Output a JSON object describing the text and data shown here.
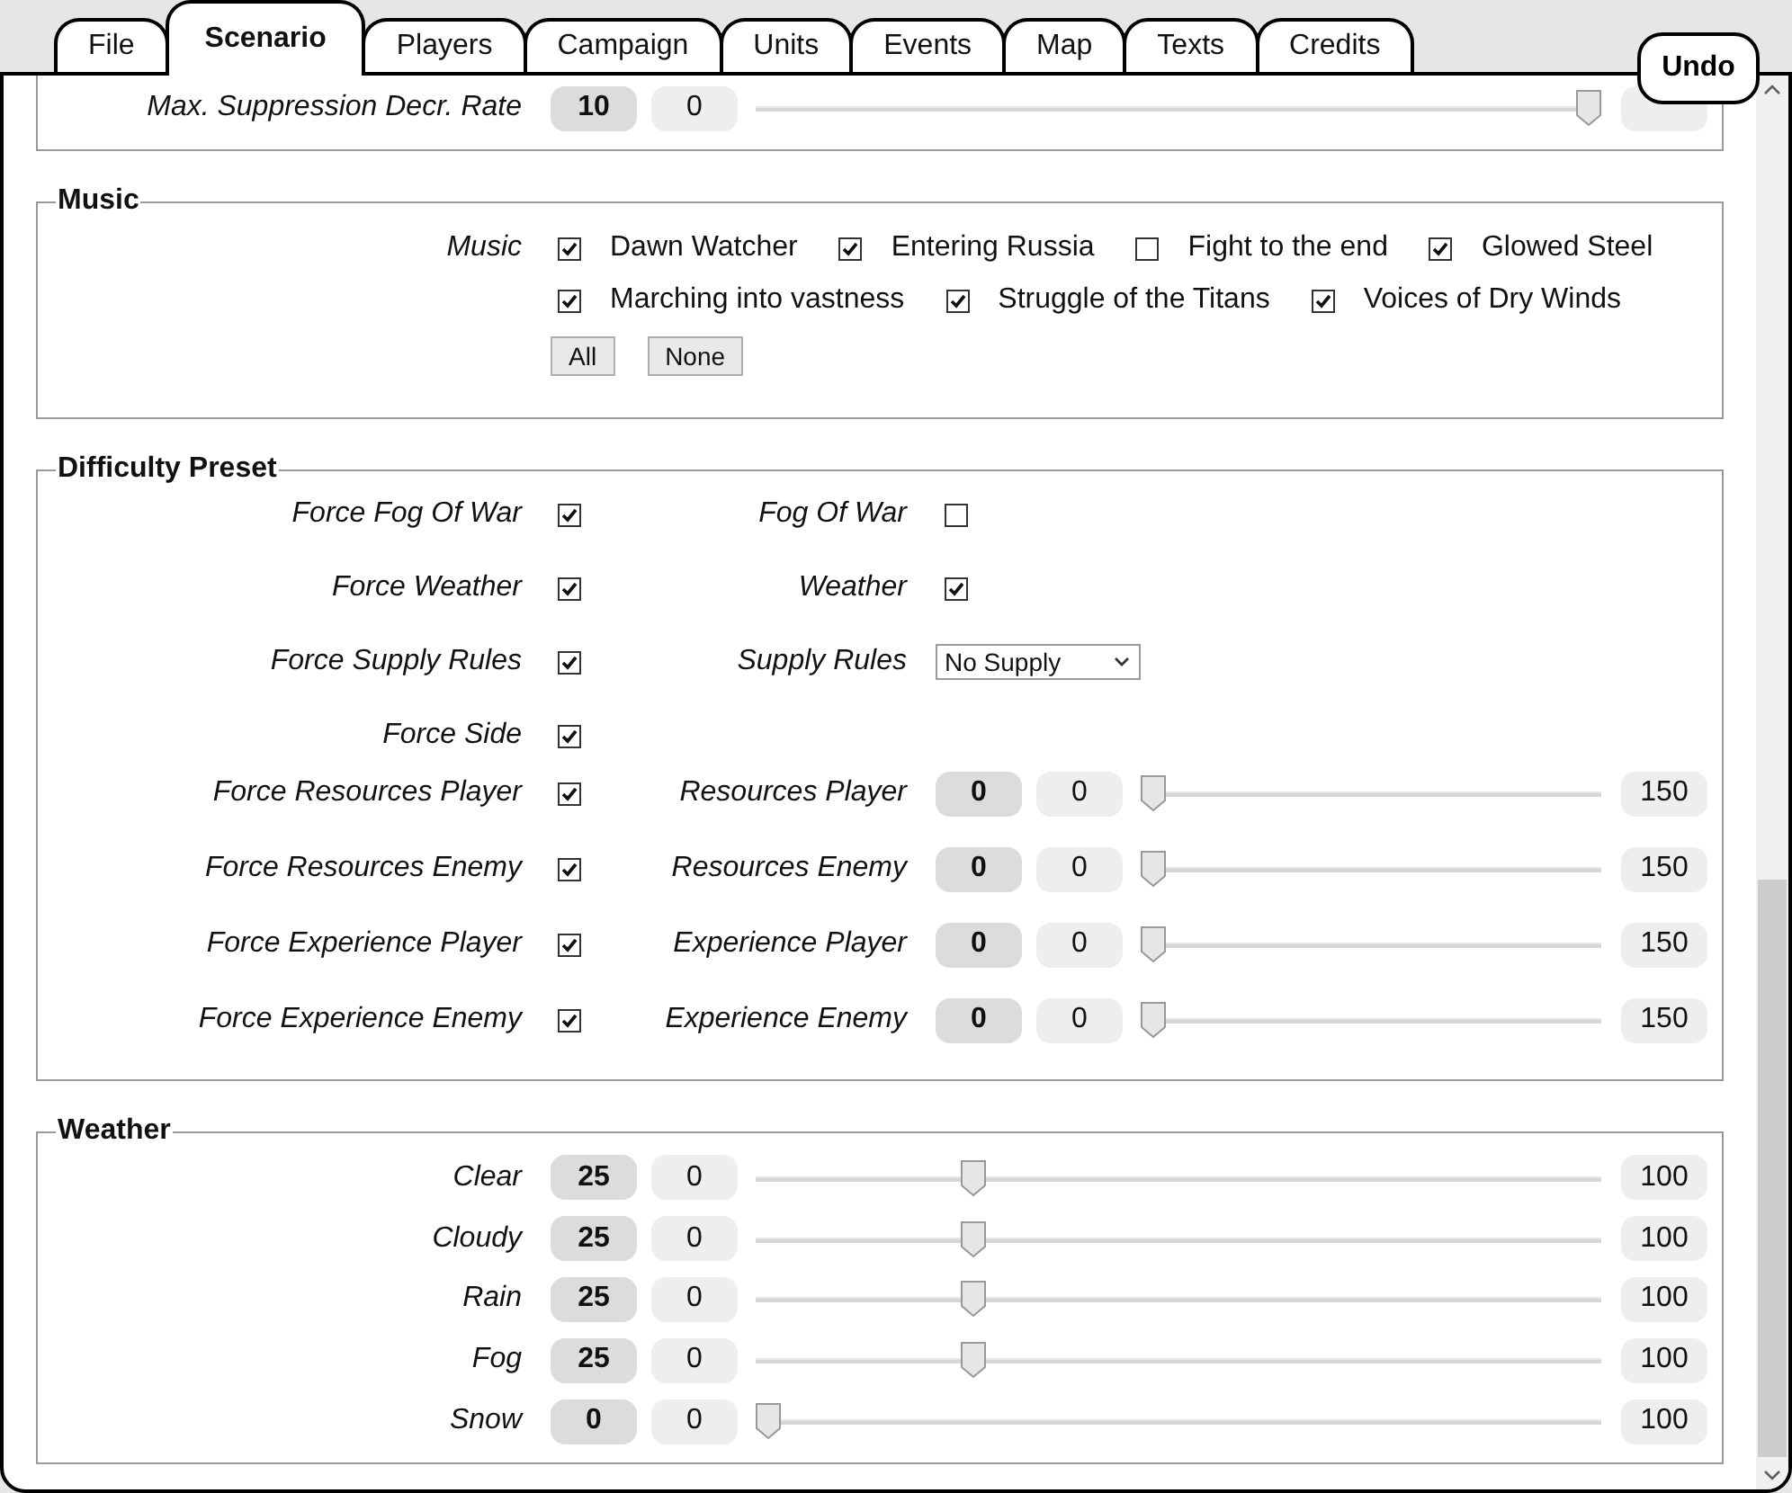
{
  "tabs": [
    {
      "label": "File",
      "selected": false
    },
    {
      "label": "Scenario",
      "selected": true
    },
    {
      "label": "Players",
      "selected": false
    },
    {
      "label": "Campaign",
      "selected": false
    },
    {
      "label": "Units",
      "selected": false
    },
    {
      "label": "Events",
      "selected": false
    },
    {
      "label": "Map",
      "selected": false
    },
    {
      "label": "Texts",
      "selected": false
    },
    {
      "label": "Credits",
      "selected": false
    }
  ],
  "undo_button": "Undo",
  "top_section": {
    "rows": [
      {
        "label": "Max. Suppression Decr. Rate",
        "value": "10",
        "min": "0",
        "level": 1
      }
    ]
  },
  "music": {
    "title": "Music",
    "label": "Music",
    "tracks": [
      {
        "name": "Dawn Watcher",
        "checked": true
      },
      {
        "name": "Entering Russia",
        "checked": true
      },
      {
        "name": "Fight to the end",
        "checked": false
      },
      {
        "name": "Glowed Steel",
        "checked": true
      },
      {
        "name": "Marching into vastness",
        "checked": true
      },
      {
        "name": "Struggle of the Titans",
        "checked": true
      },
      {
        "name": "Voices of Dry Winds",
        "checked": true
      }
    ],
    "buttons": [
      "All",
      "None"
    ]
  },
  "difficulty": {
    "title": "Difficulty Preset",
    "rows": [
      {
        "force_label": "Force Fog Of War",
        "force_checked": true,
        "setting": {
          "kind": "checkbox",
          "label": "Fog Of War",
          "checked": false
        }
      },
      {
        "force_label": "Force Weather",
        "force_checked": true,
        "setting": {
          "kind": "checkbox",
          "label": "Weather",
          "checked": true
        }
      },
      {
        "force_label": "Force Supply Rules",
        "force_checked": true,
        "setting": {
          "kind": "select",
          "label": "Supply Rules",
          "value": "No Supply"
        }
      },
      {
        "force_label": "Force Side",
        "force_checked": true
      },
      {
        "force_label": "Force Resources Player",
        "force_checked": true,
        "setting": {
          "kind": "slider",
          "label": "Resources Player",
          "value": "0",
          "min": "0",
          "max": "150",
          "level": 0
        }
      },
      {
        "force_label": "Force Resources Enemy",
        "force_checked": true,
        "setting": {
          "kind": "slider",
          "label": "Resources Enemy",
          "value": "0",
          "min": "0",
          "max": "150",
          "level": 0
        }
      },
      {
        "force_label": "Force Experience Player",
        "force_checked": true,
        "setting": {
          "kind": "slider",
          "label": "Experience Player",
          "value": "0",
          "min": "0",
          "max": "150",
          "level": 0
        }
      },
      {
        "force_label": "Force Experience Enemy",
        "force_checked": true,
        "setting": {
          "kind": "slider",
          "label": "Experience Enemy",
          "value": "0",
          "min": "0",
          "max": "150",
          "level": 0
        }
      }
    ]
  },
  "weather": {
    "title": "Weather",
    "rows": [
      {
        "label": "Clear",
        "value": "25",
        "min": "0",
        "max": "100",
        "level": 0.25
      },
      {
        "label": "Cloudy",
        "value": "25",
        "min": "0",
        "max": "100",
        "level": 0.25
      },
      {
        "label": "Rain",
        "value": "25",
        "min": "0",
        "max": "100",
        "level": 0.25
      },
      {
        "label": "Fog",
        "value": "25",
        "min": "0",
        "max": "100",
        "level": 0.25
      },
      {
        "label": "Snow",
        "value": "0",
        "min": "0",
        "max": "100",
        "level": 0
      }
    ]
  }
}
